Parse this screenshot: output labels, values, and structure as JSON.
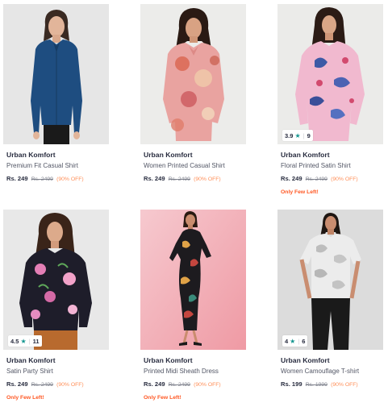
{
  "products": [
    {
      "brand": "Urban Komfort",
      "name": "Premium Fit Casual Shirt",
      "price": "Rs. 249",
      "mrp": "Rs. 2499",
      "discount": "(90% OFF)",
      "few_left": "",
      "rating": "",
      "rating_count": ""
    },
    {
      "brand": "Urban Komfort",
      "name": "Women Printed Casual Shirt",
      "price": "Rs. 249",
      "mrp": "Rs. 2499",
      "discount": "(90% OFF)",
      "few_left": "",
      "rating": "",
      "rating_count": ""
    },
    {
      "brand": "Urban Komfort",
      "name": "Floral Printed Satin Shirt",
      "price": "Rs. 249",
      "mrp": "Rs. 2499",
      "discount": "(90% OFF)",
      "few_left": "Only Few Left!",
      "rating": "3.9",
      "rating_count": "9"
    },
    {
      "brand": "Urban Komfort",
      "name": "Satin Party Shirt",
      "price": "Rs. 249",
      "mrp": "Rs. 2499",
      "discount": "(90% OFF)",
      "few_left": "Only Few Left!",
      "rating": "4.5",
      "rating_count": "11"
    },
    {
      "brand": "Urban Komfort",
      "name": "Printed Midi Sheath Dress",
      "price": "Rs. 249",
      "mrp": "Rs. 2499",
      "discount": "(90% OFF)",
      "few_left": "Only Few Left!",
      "rating": "",
      "rating_count": ""
    },
    {
      "brand": "Urban Komfort",
      "name": "Women Camouflage T-shirt",
      "price": "Rs. 199",
      "mrp": "Rs. 1999",
      "discount": "(90% OFF)",
      "few_left": "",
      "rating": "4",
      "rating_count": "6"
    }
  ],
  "icons": {
    "rating_star": "star-icon"
  },
  "colors": {
    "brand_text": "#282c3f",
    "discount": "#ff905a",
    "few_left": "#ff5722",
    "rating_star": "#14958f"
  }
}
